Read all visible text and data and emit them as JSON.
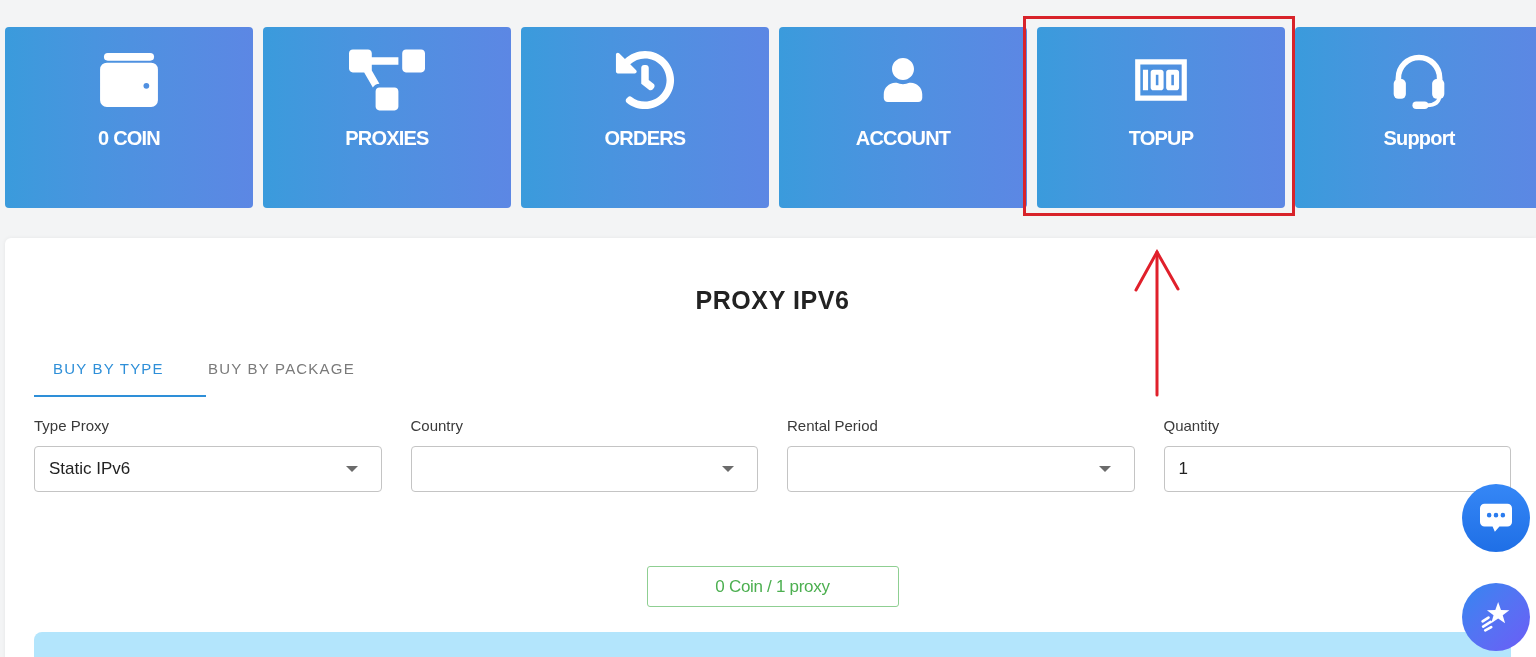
{
  "tiles": [
    {
      "kind": "wallet",
      "label": "0 COIN",
      "highlighted": false
    },
    {
      "kind": "diagram",
      "label": "PROXIES",
      "highlighted": false
    },
    {
      "kind": "history",
      "label": "ORDERS",
      "highlighted": false
    },
    {
      "kind": "user",
      "label": "ACCOUNT",
      "highlighted": false
    },
    {
      "kind": "money",
      "label": "TOPUP",
      "highlighted": true
    },
    {
      "kind": "headset",
      "label": "Support",
      "highlighted": false
    }
  ],
  "card": {
    "title": "PROXY IPV6",
    "tabs": [
      {
        "label": "BUY BY TYPE",
        "selected": true
      },
      {
        "label": "BUY BY PACKAGE",
        "selected": false
      }
    ],
    "fields": [
      {
        "kind": "select",
        "label": "Type Proxy",
        "value": "Static IPv6"
      },
      {
        "kind": "select",
        "label": "Country"
      },
      {
        "kind": "select",
        "label": "Rental Period"
      },
      {
        "kind": "input",
        "label": "Quantity",
        "value": "1"
      }
    ],
    "price": "0 Coin / 1 proxy"
  }
}
